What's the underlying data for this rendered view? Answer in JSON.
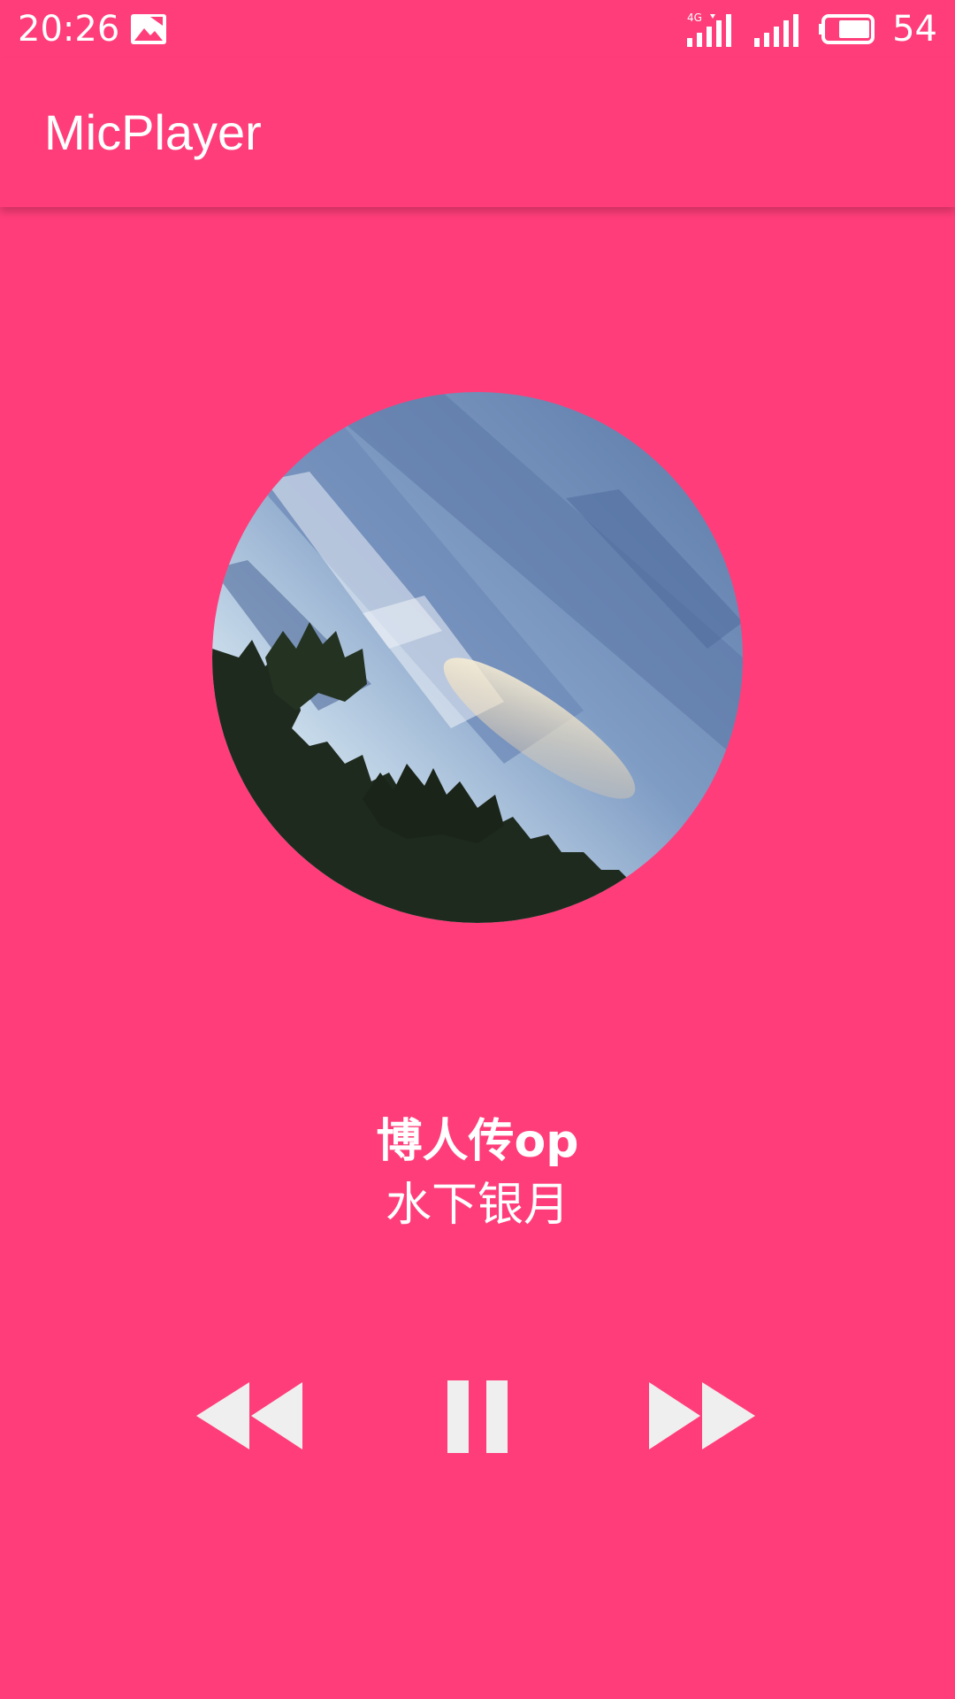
{
  "status_bar": {
    "time": "20:26",
    "gallery_icon": "image-notification-icon",
    "network_label": "4G",
    "battery_level": "54"
  },
  "app_bar": {
    "title": "MicPlayer"
  },
  "now_playing": {
    "album_art": "sky-with-clouds-and-trees",
    "title": "博人传op",
    "artist": "水下银月"
  },
  "controls": {
    "previous_icon": "rewind-icon",
    "pause_icon": "pause-icon",
    "next_icon": "fast-forward-icon"
  },
  "colors": {
    "accent": "#ff3d7a",
    "icon": "#efefef"
  }
}
